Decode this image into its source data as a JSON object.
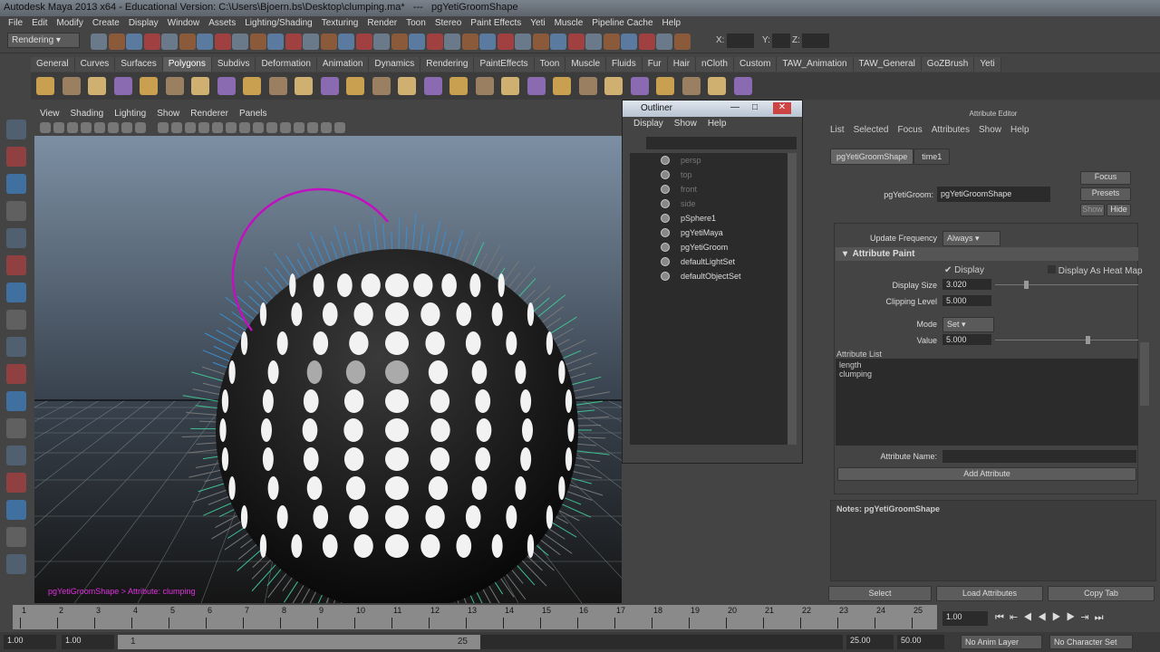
{
  "window": {
    "title": "Autodesk Maya 2013 x64 - Educational Version: C:\\Users\\Bjoern.bs\\Desktop\\clumping.ma*   ---   pgYetiGroomShape"
  },
  "menu": [
    "File",
    "Edit",
    "Modify",
    "Create",
    "Display",
    "Window",
    "Assets",
    "Lighting/Shading",
    "Texturing",
    "Render",
    "Toon",
    "Stereo",
    "Paint Effects",
    "Yeti",
    "Muscle",
    "Pipeline Cache",
    "Help"
  ],
  "status": {
    "menuset": "Rendering",
    "x_label": "X:",
    "y_label": "Y:",
    "z_label": "Z:"
  },
  "shelf_tabs": [
    "General",
    "Curves",
    "Surfaces",
    "Polygons",
    "Subdivs",
    "Deformation",
    "Animation",
    "Dynamics",
    "Rendering",
    "PaintEffects",
    "Toon",
    "Muscle",
    "Fluids",
    "Fur",
    "Hair",
    "nCloth",
    "Custom",
    "TAW_Animation",
    "TAW_General",
    "GoZBrush",
    "Yeti"
  ],
  "viewport": {
    "menu": [
      "View",
      "Shading",
      "Lighting",
      "Show",
      "Renderer",
      "Panels"
    ],
    "hud": "pgYetiGroomShape > Attribute: clumping"
  },
  "outliner": {
    "title": "Outliner",
    "menu": [
      "Display",
      "Show",
      "Help"
    ],
    "items": [
      {
        "name": "persp",
        "dim": true
      },
      {
        "name": "top",
        "dim": true
      },
      {
        "name": "front",
        "dim": true
      },
      {
        "name": "side",
        "dim": true
      },
      {
        "name": "pSphere1"
      },
      {
        "name": "pgYetiMaya"
      },
      {
        "name": "pgYetiGroom"
      },
      {
        "name": "defaultLightSet"
      },
      {
        "name": "defaultObjectSet"
      }
    ]
  },
  "ae": {
    "title": "Attribute Editor",
    "menu": [
      "List",
      "Selected",
      "Focus",
      "Attributes",
      "Show",
      "Help"
    ],
    "tabs": [
      "pgYetiGroomShape",
      "time1"
    ],
    "node_label": "pgYetiGroom:",
    "node_value": "pgYetiGroomShape",
    "focus": "Focus",
    "presets": "Presets",
    "show": "Show",
    "hide": "Hide",
    "update_freq_label": "Update Frequency",
    "update_freq": "Always",
    "section": "Attribute Paint",
    "display": "Display",
    "heatmap": "Display As Heat Map",
    "display_size_label": "Display Size",
    "display_size": "3.020",
    "clip_label": "Clipping Level",
    "clip": "5.000",
    "mode_label": "Mode",
    "mode": "Set",
    "value_label": "Value",
    "value": "5.000",
    "attr_list_label": "Attribute List",
    "attr_list": [
      "length",
      "clumping"
    ],
    "attr_name_label": "Attribute Name:",
    "add_attr": "Add Attribute",
    "notes": "Notes:  pgYetiGroomShape",
    "select": "Select",
    "load": "Load Attributes",
    "copy": "Copy Tab"
  },
  "timeline": {
    "ticks": [
      "1",
      "2",
      "3",
      "4",
      "5",
      "6",
      "7",
      "8",
      "9",
      "10",
      "11",
      "12",
      "13",
      "14",
      "15",
      "16",
      "17",
      "18",
      "19",
      "20",
      "21",
      "22",
      "23",
      "24",
      "25"
    ],
    "current": "1.00"
  },
  "range": {
    "start": "1.00",
    "start2": "1.00",
    "slider_start": "1",
    "slider_end": "25",
    "end": "25.00",
    "end2": "50.00",
    "anim_layer": "No Anim Layer",
    "char_set": "No Character Set"
  }
}
